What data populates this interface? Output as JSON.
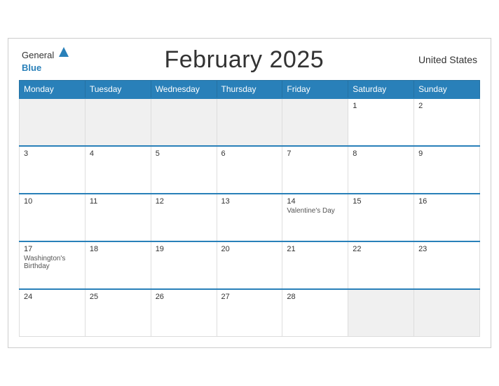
{
  "header": {
    "logo_general": "General",
    "logo_blue": "Blue",
    "title": "February 2025",
    "country": "United States"
  },
  "days_of_week": [
    "Monday",
    "Tuesday",
    "Wednesday",
    "Thursday",
    "Friday",
    "Saturday",
    "Sunday"
  ],
  "weeks": [
    [
      {
        "day": "",
        "empty": true
      },
      {
        "day": "",
        "empty": true
      },
      {
        "day": "",
        "empty": true
      },
      {
        "day": "",
        "empty": true
      },
      {
        "day": "",
        "empty": true
      },
      {
        "day": "1",
        "event": ""
      },
      {
        "day": "2",
        "event": ""
      }
    ],
    [
      {
        "day": "3",
        "event": ""
      },
      {
        "day": "4",
        "event": ""
      },
      {
        "day": "5",
        "event": ""
      },
      {
        "day": "6",
        "event": ""
      },
      {
        "day": "7",
        "event": ""
      },
      {
        "day": "8",
        "event": ""
      },
      {
        "day": "9",
        "event": ""
      }
    ],
    [
      {
        "day": "10",
        "event": ""
      },
      {
        "day": "11",
        "event": ""
      },
      {
        "day": "12",
        "event": ""
      },
      {
        "day": "13",
        "event": ""
      },
      {
        "day": "14",
        "event": "Valentine's Day"
      },
      {
        "day": "15",
        "event": ""
      },
      {
        "day": "16",
        "event": ""
      }
    ],
    [
      {
        "day": "17",
        "event": "Washington's Birthday"
      },
      {
        "day": "18",
        "event": ""
      },
      {
        "day": "19",
        "event": ""
      },
      {
        "day": "20",
        "event": ""
      },
      {
        "day": "21",
        "event": ""
      },
      {
        "day": "22",
        "event": ""
      },
      {
        "day": "23",
        "event": ""
      }
    ],
    [
      {
        "day": "24",
        "event": ""
      },
      {
        "day": "25",
        "event": ""
      },
      {
        "day": "26",
        "event": ""
      },
      {
        "day": "27",
        "event": ""
      },
      {
        "day": "28",
        "event": ""
      },
      {
        "day": "",
        "empty": true
      },
      {
        "day": "",
        "empty": true
      }
    ]
  ]
}
